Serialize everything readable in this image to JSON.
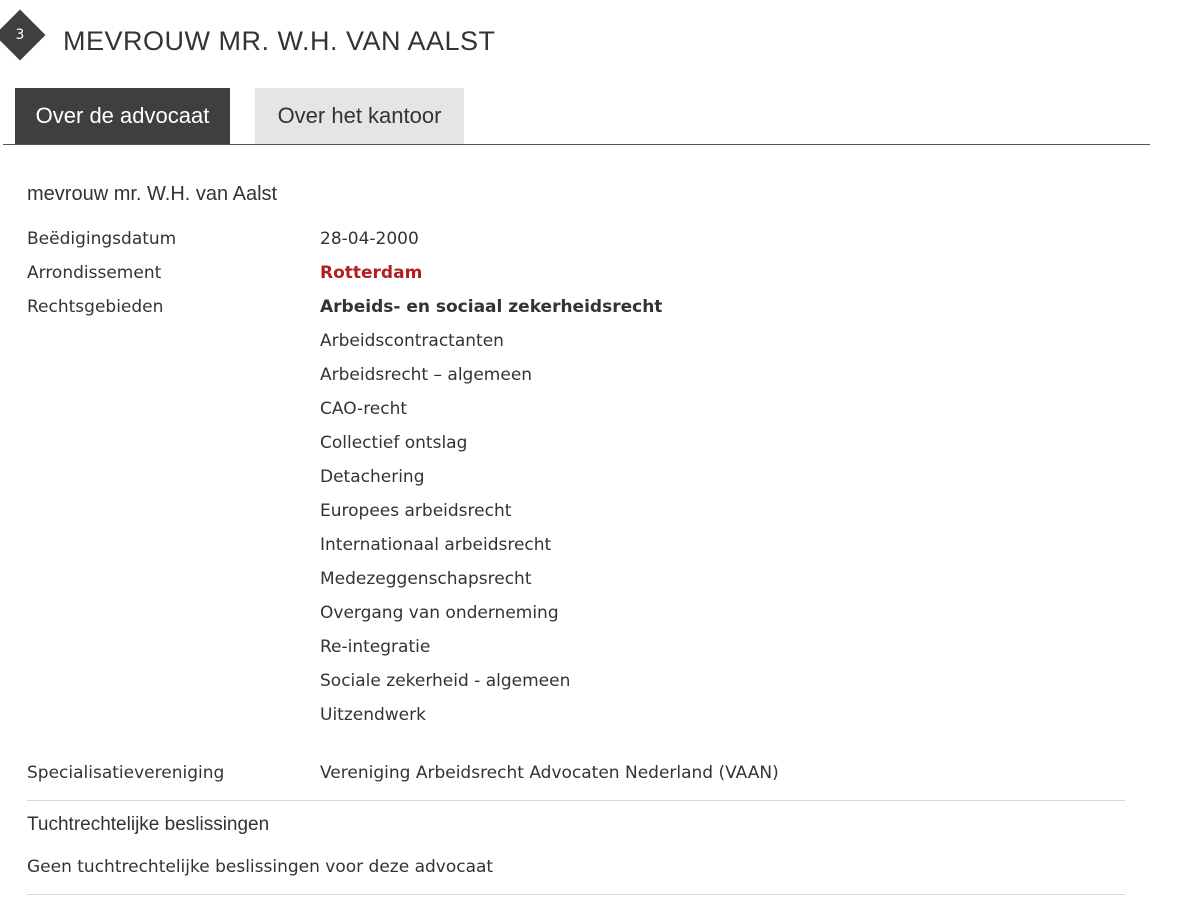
{
  "header": {
    "badge_number": "3",
    "title": "MEVROUW MR. W.H. VAN AALST"
  },
  "tabs": [
    {
      "label": "Over de advocaat",
      "active": true
    },
    {
      "label": "Over het kantoor",
      "active": false
    }
  ],
  "profile": {
    "name": "mevrouw mr. W.H. van Aalst",
    "sworn_in": {
      "label": "Beëdigingsdatum",
      "value": "28-04-2000"
    },
    "district": {
      "label": "Arrondissement",
      "value": "Rotterdam"
    },
    "practice_areas": {
      "label": "Rechtsgebieden",
      "main": "Arbeids- en sociaal zekerheidsrecht",
      "items": [
        "Arbeidscontractanten",
        "Arbeidsrecht – algemeen",
        "CAO-recht",
        "Collectief ontslag",
        "Detachering",
        "Europees arbeidsrecht",
        "Internationaal arbeidsrecht",
        "Medezeggenschapsrecht",
        "Overgang van onderneming",
        "Re-integratie",
        "Sociale zekerheid - algemeen",
        "Uitzendwerk"
      ]
    },
    "specialisation": {
      "label": "Specialisatievereniging",
      "value": "Vereniging Arbeidsrecht Advocaten Nederland (VAAN)"
    }
  },
  "disciplinary": {
    "title": "Tuchtrechtelijke beslissingen",
    "text": "Geen tuchtrechtelijke beslissingen voor deze advocaat"
  },
  "colors": {
    "tab_active_bg": "#3f3f41",
    "tab_inactive_bg": "#e5e5e5",
    "accent_red": "#b01e23",
    "text": "#333333"
  }
}
